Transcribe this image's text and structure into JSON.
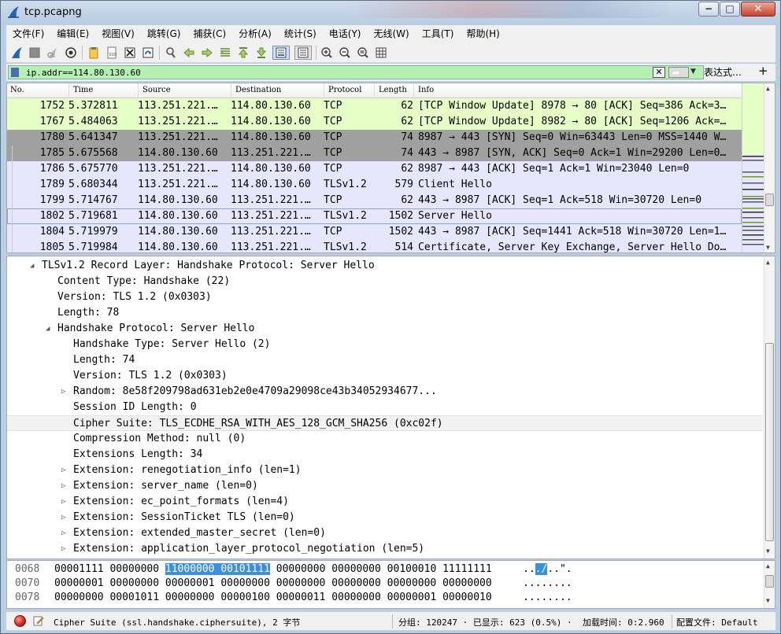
{
  "window": {
    "title": "tcp.pcapng",
    "buttons": {
      "minimize": "−",
      "maximize": "□",
      "close": "✕"
    }
  },
  "menubar": {
    "items": [
      {
        "label": "文件(F)"
      },
      {
        "label": "编辑(E)"
      },
      {
        "label": "视图(V)"
      },
      {
        "label": "跳转(G)"
      },
      {
        "label": "捕获(C)"
      },
      {
        "label": "分析(A)"
      },
      {
        "label": "统计(S)"
      },
      {
        "label": "电话(Y)"
      },
      {
        "label": "无线(W)"
      },
      {
        "label": "工具(T)"
      },
      {
        "label": "帮助(H)"
      }
    ]
  },
  "toolbar": {
    "icons": [
      "start-capture-icon",
      "stop-capture-icon",
      "restart-capture-icon",
      "capture-options-icon",
      "open-file-icon",
      "save-file-icon",
      "close-file-icon",
      "reload-file-icon",
      "find-packet-icon",
      "go-back-icon",
      "go-forward-icon",
      "go-to-packet-icon",
      "go-first-icon",
      "go-last-icon",
      "auto-scroll-icon",
      "colorize-icon",
      "zoom-in-icon",
      "zoom-out-icon",
      "zoom-normal-icon",
      "resize-columns-icon"
    ]
  },
  "filter": {
    "value": "ip.addr==114.80.130.60",
    "clear_label": "✕",
    "apply_label": "➡",
    "dropdown_label": "▼",
    "expression_label": "表达式…",
    "add_label": "+"
  },
  "packet_list": {
    "headers": {
      "no": "No.",
      "time": "Time",
      "source": "Source",
      "destination": "Destination",
      "protocol": "Protocol",
      "length": "Length",
      "info": "Info"
    },
    "rows": [
      {
        "no": "1752",
        "time": "5.372811",
        "source": "113.251.221.…",
        "destination": "114.80.130.60",
        "protocol": "TCP",
        "length": "62",
        "info": "[TCP Window Update] 8978 → 80 [ACK] Seq=386 Ack=3…",
        "bg": "#e6ffc6",
        "fg": "#000000"
      },
      {
        "no": "1767",
        "time": "5.484063",
        "source": "113.251.221.…",
        "destination": "114.80.130.60",
        "protocol": "TCP",
        "length": "62",
        "info": "[TCP Window Update] 8982 → 80 [ACK] Seq=1206 Ack=…",
        "bg": "#e6ffc6",
        "fg": "#000000"
      },
      {
        "no": "1780",
        "time": "5.641347",
        "source": "113.251.221.…",
        "destination": "114.80.130.60",
        "protocol": "TCP",
        "length": "74",
        "info": "8987 → 443 [SYN] Seq=0 Win=63443 Len=0 MSS=1440 W…",
        "bg": "#a0a0a0",
        "fg": "#000000"
      },
      {
        "no": "1785",
        "time": "5.675568",
        "source": "114.80.130.60",
        "destination": "113.251.221.…",
        "protocol": "TCP",
        "length": "74",
        "info": "443 → 8987 [SYN, ACK] Seq=0 Ack=1 Win=29200 Len=0…",
        "bg": "#a0a0a0",
        "fg": "#000000"
      },
      {
        "no": "1786",
        "time": "5.675770",
        "source": "113.251.221.…",
        "destination": "114.80.130.60",
        "protocol": "TCP",
        "length": "62",
        "info": "8987 → 443 [ACK] Seq=1 Ack=1 Win=23040 Len=0",
        "bg": "#e7e6ff",
        "fg": "#000000"
      },
      {
        "no": "1789",
        "time": "5.680344",
        "source": "113.251.221.…",
        "destination": "114.80.130.60",
        "protocol": "TLSv1.2",
        "length": "579",
        "info": "Client Hello",
        "bg": "#e7e6ff",
        "fg": "#000000"
      },
      {
        "no": "1799",
        "time": "5.714767",
        "source": "114.80.130.60",
        "destination": "113.251.221.…",
        "protocol": "TCP",
        "length": "62",
        "info": "443 → 8987 [ACK] Seq=1 Ack=518 Win=30720 Len=0",
        "bg": "#e7e6ff",
        "fg": "#000000"
      },
      {
        "no": "1802",
        "time": "5.719681",
        "source": "114.80.130.60",
        "destination": "113.251.221.…",
        "protocol": "TLSv1.2",
        "length": "1502",
        "info": "Server Hello",
        "bg": "#e7e6ff",
        "fg": "#000000",
        "selected": true
      },
      {
        "no": "1804",
        "time": "5.719979",
        "source": "114.80.130.60",
        "destination": "113.251.221.…",
        "protocol": "TCP",
        "length": "1502",
        "info": "443 → 8987 [ACK] Seq=1441 Ack=518 Win=30720 Len=1…",
        "bg": "#e7e6ff",
        "fg": "#000000"
      },
      {
        "no": "1805",
        "time": "5.719984",
        "source": "114.80.130.60",
        "destination": "113.251.221.…",
        "protocol": "TLSv1.2",
        "length": "514",
        "info": "Certificate, Server Key Exchange, Server Hello Do…",
        "bg": "#e7e6ff",
        "fg": "#000000"
      }
    ]
  },
  "details": {
    "rows": [
      {
        "level": 1,
        "expander": "open",
        "text": "TLSv1.2 Record Layer: Handshake Protocol: Server Hello"
      },
      {
        "level": 2,
        "expander": "none",
        "text": "Content Type: Handshake (22)"
      },
      {
        "level": 2,
        "expander": "none",
        "text": "Version: TLS 1.2 (0x0303)"
      },
      {
        "level": 2,
        "expander": "none",
        "text": "Length: 78"
      },
      {
        "level": 2,
        "expander": "open",
        "text": "Handshake Protocol: Server Hello"
      },
      {
        "level": 3,
        "expander": "none",
        "text": "Handshake Type: Server Hello (2)"
      },
      {
        "level": 3,
        "expander": "none",
        "text": "Length: 74"
      },
      {
        "level": 3,
        "expander": "none",
        "text": "Version: TLS 1.2 (0x0303)"
      },
      {
        "level": 3,
        "expander": "closed",
        "text": "Random: 8e58f209798ad631eb2e0e4709a29098ce43b34052934677..."
      },
      {
        "level": 3,
        "expander": "none",
        "text": "Session ID Length: 0"
      },
      {
        "level": 3,
        "expander": "none",
        "text": "Cipher Suite: TLS_ECDHE_RSA_WITH_AES_128_GCM_SHA256 (0xc02f)",
        "highlight": true
      },
      {
        "level": 3,
        "expander": "none",
        "text": "Compression Method: null (0)"
      },
      {
        "level": 3,
        "expander": "none",
        "text": "Extensions Length: 34"
      },
      {
        "level": 3,
        "expander": "closed",
        "text": "Extension: renegotiation_info (len=1)"
      },
      {
        "level": 3,
        "expander": "closed",
        "text": "Extension: server_name (len=0)"
      },
      {
        "level": 3,
        "expander": "closed",
        "text": "Extension: ec_point_formats (len=4)"
      },
      {
        "level": 3,
        "expander": "closed",
        "text": "Extension: SessionTicket TLS (len=0)"
      },
      {
        "level": 3,
        "expander": "closed",
        "text": "Extension: extended_master_secret (len=0)"
      },
      {
        "level": 3,
        "expander": "closed",
        "text": "Extension: application_layer_protocol_negotiation (len=5)"
      }
    ]
  },
  "bytes": {
    "rows": [
      {
        "offset": "0068",
        "pre": "00001111 00000000 ",
        "hl": "11000000 00101111",
        "post": " 00000000 00000000 00100010 11111111",
        "ascii_pre": "..",
        "ascii_hl": "./",
        "ascii_post": "..\"."
      },
      {
        "offset": "0070",
        "pre": "00000001 00000000 00000001 00000000 00000000 00000000 00000000 00000000",
        "hl": "",
        "post": "",
        "ascii_pre": "........",
        "ascii_hl": "",
        "ascii_post": ""
      },
      {
        "offset": "0078",
        "pre": "00000000 00001011 00000000 00000100 00000011 00000000 00000001 00000010",
        "hl": "",
        "post": "",
        "ascii_pre": "........",
        "ascii_hl": "",
        "ascii_post": ""
      }
    ]
  },
  "status": {
    "field": "Cipher Suite (ssl.handshake.ciphersuite), 2 字节",
    "packets": "分组: 120247 · 已显示: 623 (0.5%) ·",
    "load_time": "加载时间: 0:2.960",
    "profile": "配置文件: Default"
  }
}
